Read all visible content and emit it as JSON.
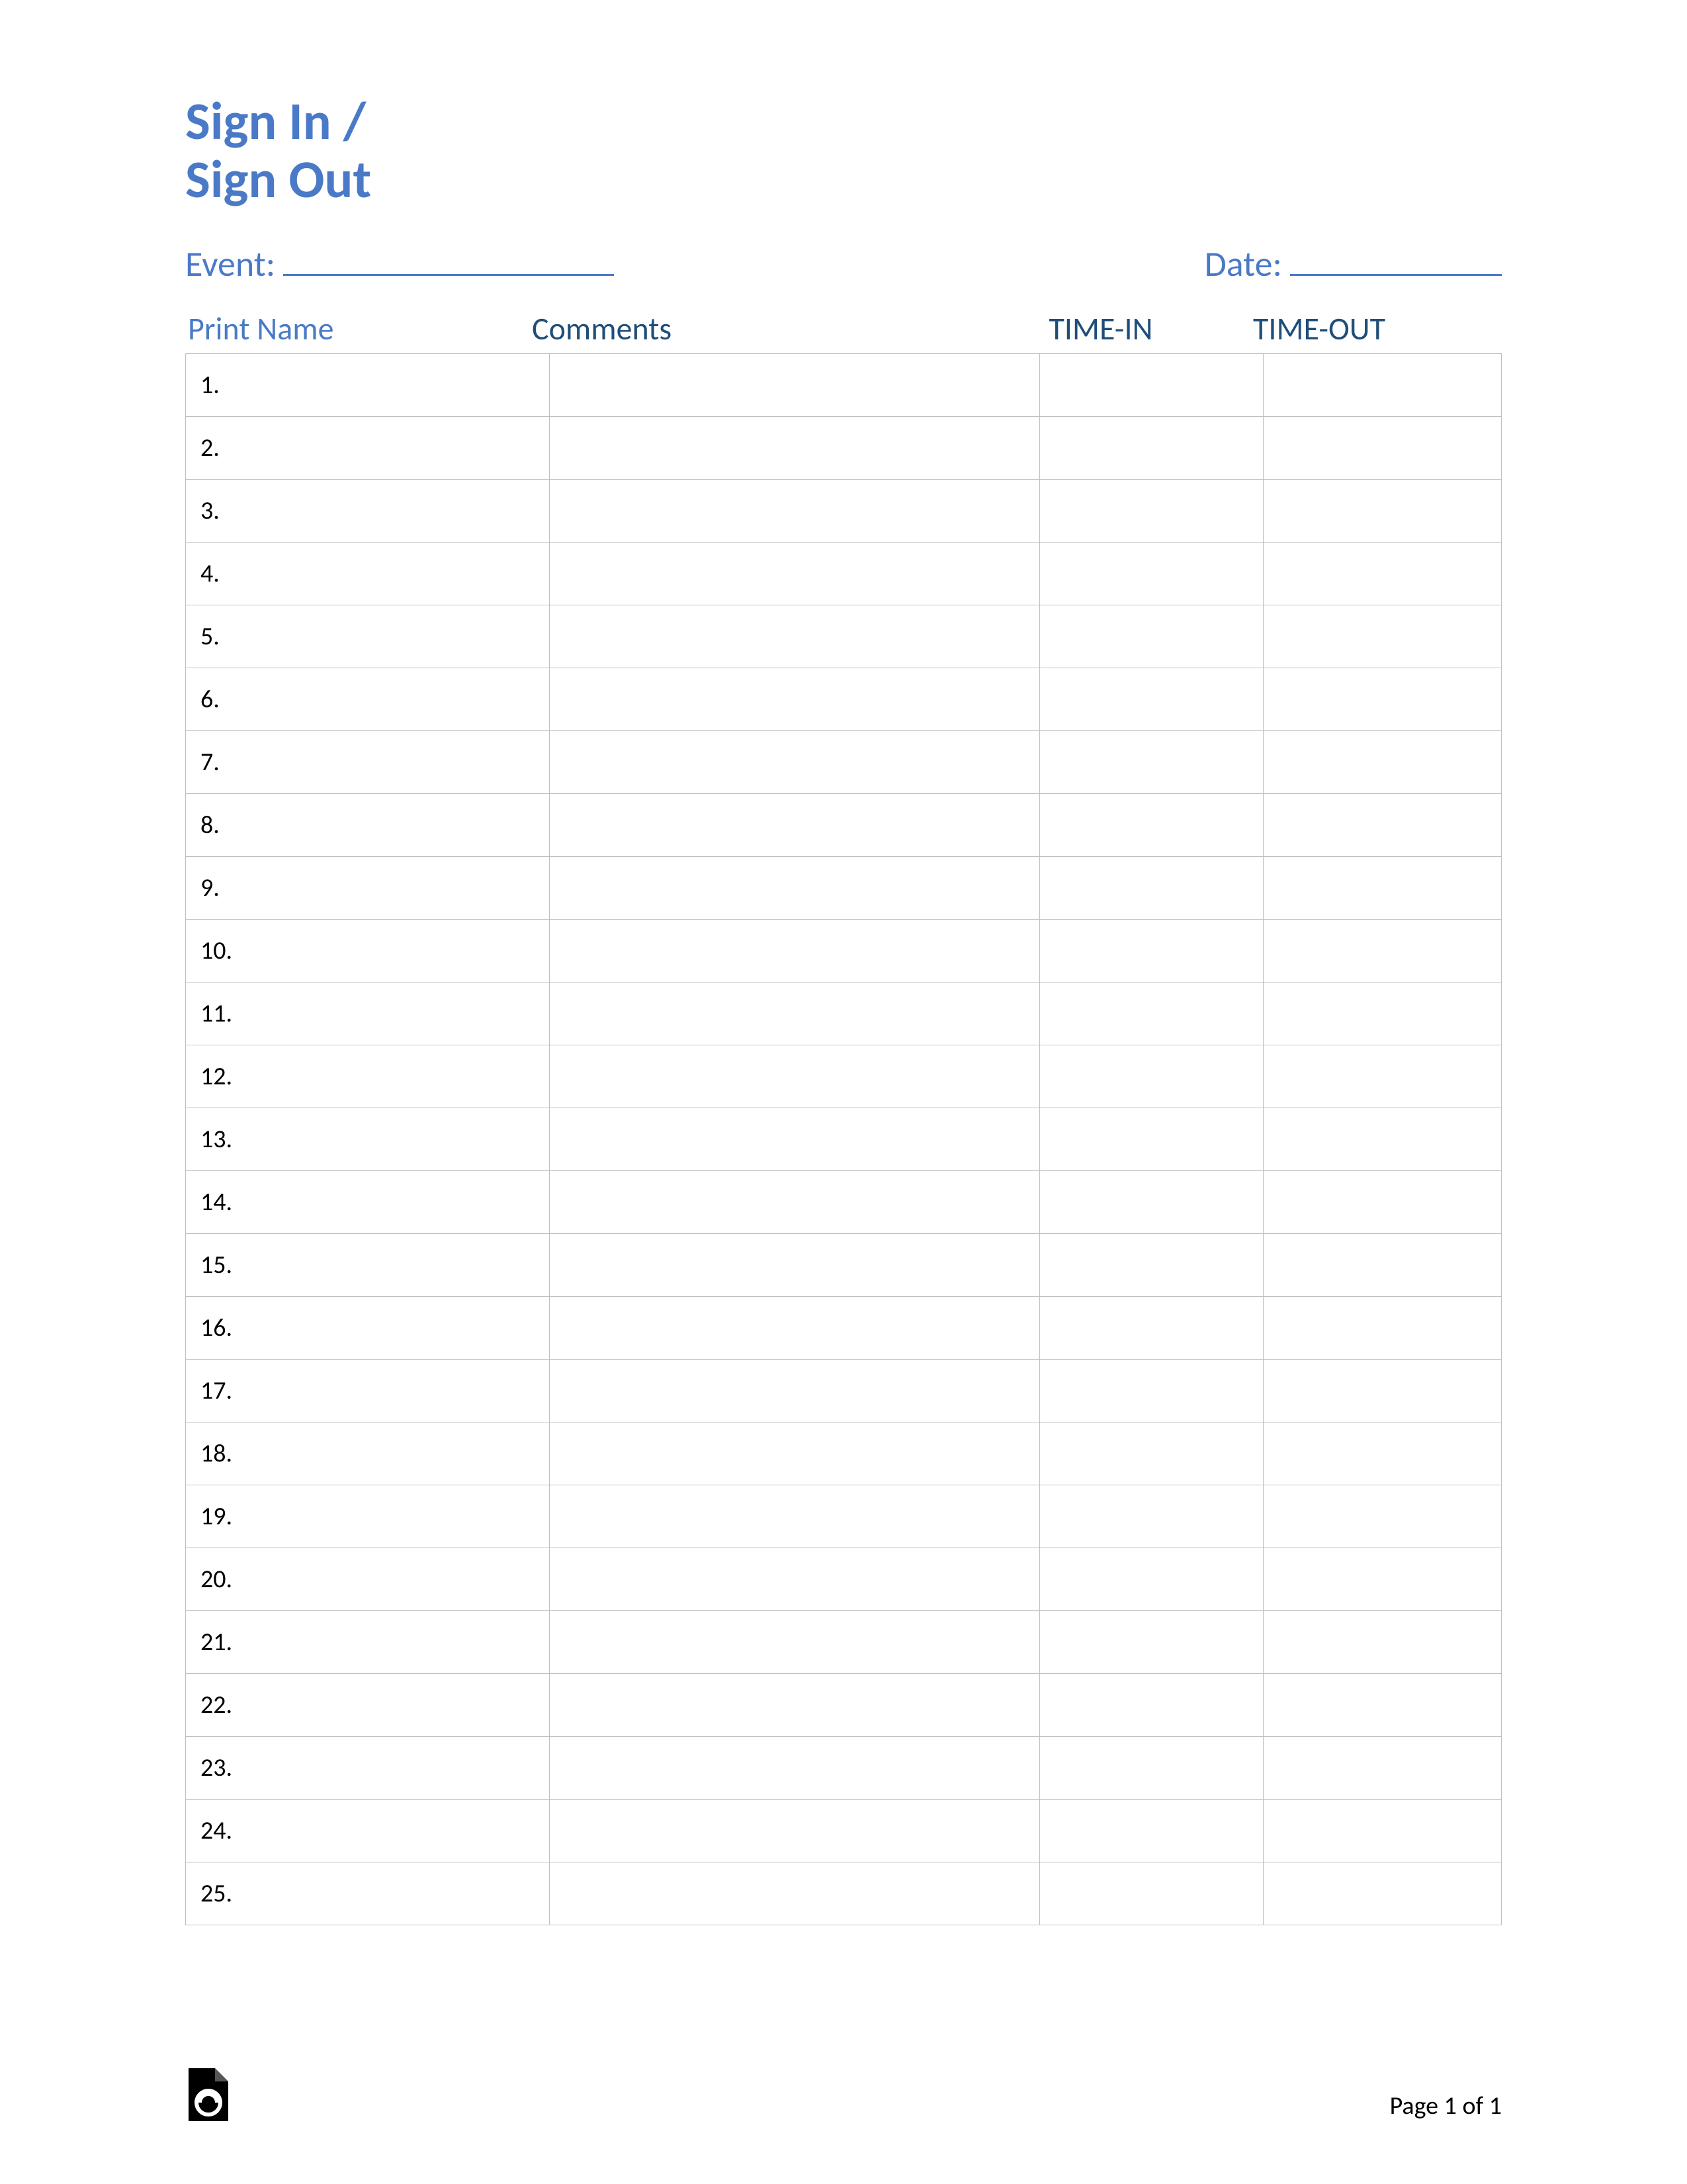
{
  "title_line1": "Sign In /",
  "title_line2": "Sign Out",
  "event_label": "Event:",
  "date_label": "Date:",
  "columns": {
    "name": "Print Name",
    "comments": "Comments",
    "timein": "TIME-IN",
    "timeout": "TIME-OUT"
  },
  "rows": [
    {
      "num": "1."
    },
    {
      "num": "2."
    },
    {
      "num": "3."
    },
    {
      "num": "4."
    },
    {
      "num": "5."
    },
    {
      "num": "6."
    },
    {
      "num": "7."
    },
    {
      "num": "8."
    },
    {
      "num": "9."
    },
    {
      "num": "10."
    },
    {
      "num": "11."
    },
    {
      "num": "12."
    },
    {
      "num": "13."
    },
    {
      "num": "14."
    },
    {
      "num": "15."
    },
    {
      "num": "16."
    },
    {
      "num": "17."
    },
    {
      "num": "18."
    },
    {
      "num": "19."
    },
    {
      "num": "20."
    },
    {
      "num": "21."
    },
    {
      "num": "22."
    },
    {
      "num": "23."
    },
    {
      "num": "24."
    },
    {
      "num": "25."
    }
  ],
  "footer": {
    "page_text": "Page 1 of 1"
  }
}
